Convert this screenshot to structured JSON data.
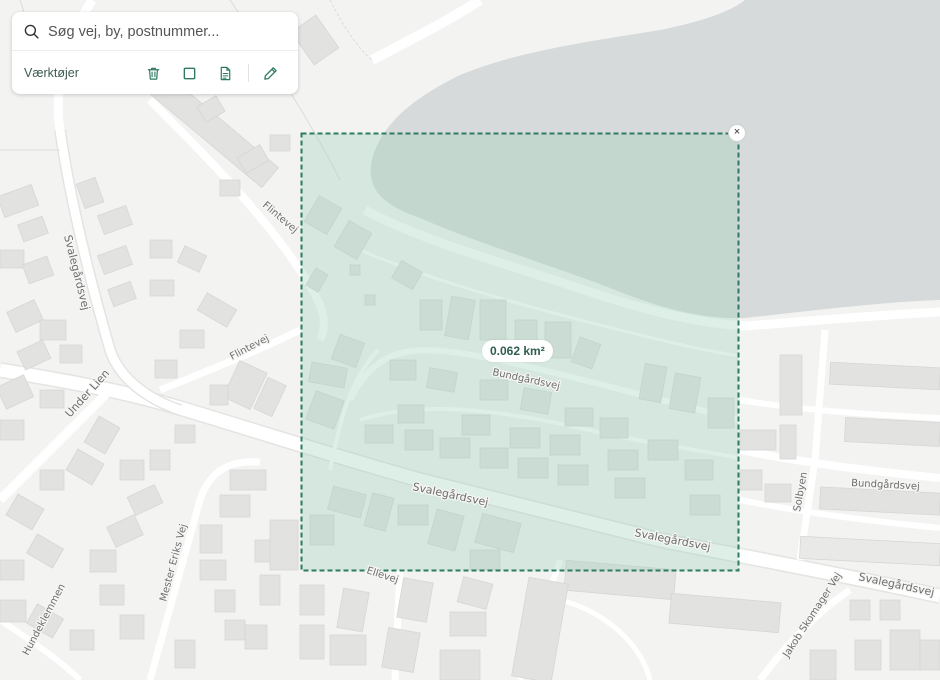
{
  "search": {
    "placeholder": "Søg vej, by, postnummer..."
  },
  "toolbar": {
    "label": "Værktøjer",
    "tools": [
      {
        "name": "delete-tool",
        "icon": "trash-icon"
      },
      {
        "name": "rectangle-tool",
        "icon": "square-icon"
      },
      {
        "name": "document-tool",
        "icon": "document-icon"
      },
      {
        "name": "draw-tool",
        "icon": "pencil-icon"
      }
    ]
  },
  "selection": {
    "area_label": "0.062 km²",
    "close_symbol": "×"
  },
  "map": {
    "streets": {
      "svalegardsvej": "Svalegårdsvej",
      "flintevej": "Flintevej",
      "under_lien": "Under Lien",
      "bundgardsvej": "Bundgårdsvej",
      "solbyen": "Solbyen",
      "mester_eriks_vej": "Mester Eriks Vej",
      "hundeklemmen": "Hundeklemmen",
      "jakob_skomager_vej": "Jakob Skomager Vej",
      "ellevej": "Ellevej"
    }
  },
  "colors": {
    "accent": "#2f7a63",
    "water": "#d7dadb",
    "selection_fill": "#c9e6d9",
    "building": "#e2e2e1",
    "road": "#ffffff"
  }
}
